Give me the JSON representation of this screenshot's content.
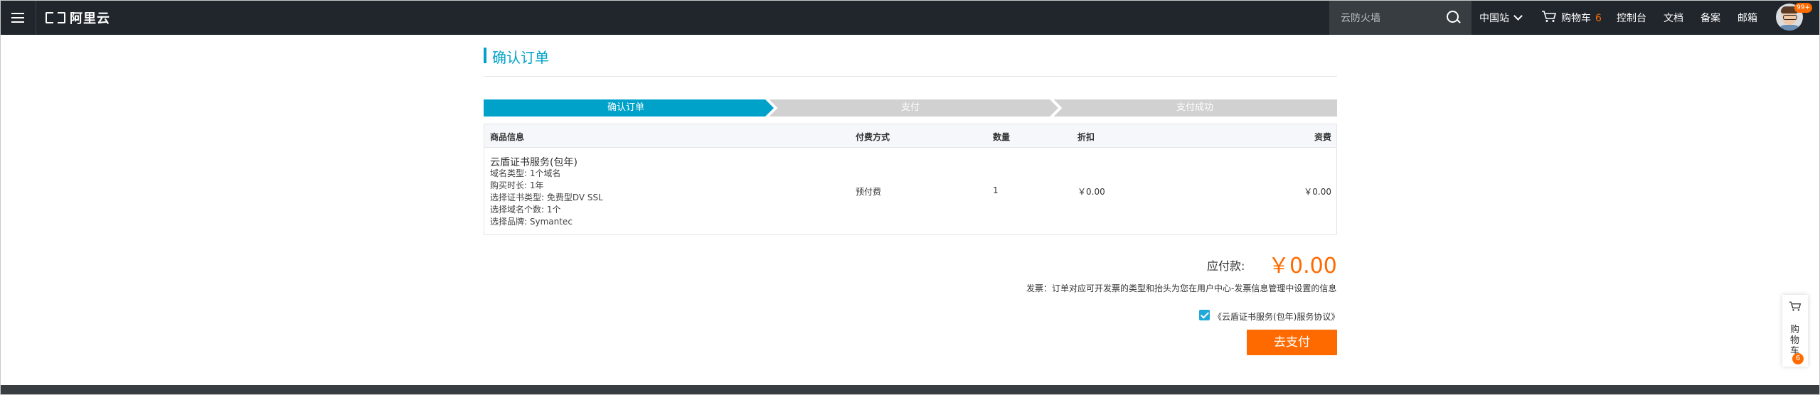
{
  "header": {
    "logo_text": "阿里云",
    "search_placeholder": "云防火墙",
    "region_label": "中国站",
    "cart_label": "购物车",
    "cart_count": "6",
    "nav_console": "控制台",
    "nav_docs": "文档",
    "nav_beian": "备案",
    "nav_mail": "邮箱",
    "avatar_badge": "99+"
  },
  "page": {
    "title": "确认订单",
    "steps": [
      "确认订单",
      "支付",
      "支付成功"
    ],
    "active_step": 0
  },
  "colors": {
    "accent": "#00a2ca",
    "step_active": "#00a2ca",
    "step_inactive": "#d1d1d1",
    "primary_button": "#ff6a00",
    "header_bg": "#20262c"
  },
  "table": {
    "headers": {
      "product": "商品信息",
      "payment": "付费方式",
      "quantity": "数量",
      "discount": "折扣",
      "fee": "资费"
    },
    "row": {
      "product_name": "云盾证书服务(包年)",
      "details": [
        "域名类型: 1个域名",
        "购买时长: 1年",
        "选择证书类型: 免费型DV SSL",
        "选择域名个数: 1个",
        "选择品牌: Symantec"
      ],
      "payment": "预付费",
      "quantity": "1",
      "discount": "￥0.00",
      "fee": "￥0.00"
    }
  },
  "summary": {
    "payable_label": "应付款:",
    "payable_amount": "￥0.00",
    "invoice_note": "发票：订单对应可开发票的类型和抬头为您在用户中心-发票信息管理中设置的信息",
    "agreement_text": "《云盾证书服务(包年)服务协议》",
    "agreement_checked": true,
    "pay_button": "去支付"
  },
  "side_cart": {
    "label": "购物车",
    "count": "6"
  }
}
